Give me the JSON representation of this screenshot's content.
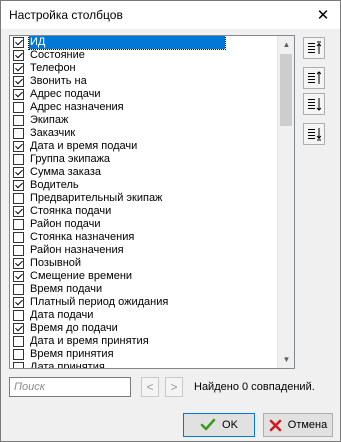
{
  "window": {
    "title": "Настройка столбцов"
  },
  "columns": [
    {
      "label": "ИД",
      "checked": true,
      "selected": true
    },
    {
      "label": "Состояние",
      "checked": true
    },
    {
      "label": "Телефон",
      "checked": true
    },
    {
      "label": "Звонить на",
      "checked": true
    },
    {
      "label": "Адрес подачи",
      "checked": true
    },
    {
      "label": "Адрес назначения",
      "checked": false
    },
    {
      "label": "Экипаж",
      "checked": false
    },
    {
      "label": "Заказчик",
      "checked": false
    },
    {
      "label": "Дата и время подачи",
      "checked": true
    },
    {
      "label": "Группа экипажа",
      "checked": false
    },
    {
      "label": "Сумма заказа",
      "checked": true
    },
    {
      "label": "Водитель",
      "checked": true
    },
    {
      "label": "Предварительный экипаж",
      "checked": false
    },
    {
      "label": "Стоянка подачи",
      "checked": true
    },
    {
      "label": "Район подачи",
      "checked": false
    },
    {
      "label": "Стоянка назначения",
      "checked": false
    },
    {
      "label": "Район назначения",
      "checked": false
    },
    {
      "label": "Позывной",
      "checked": true
    },
    {
      "label": "Смещение времени",
      "checked": true
    },
    {
      "label": "Время подачи",
      "checked": false
    },
    {
      "label": "Платный период ожидания",
      "checked": true
    },
    {
      "label": "Дата подачи",
      "checked": false
    },
    {
      "label": "Время до подачи",
      "checked": true
    },
    {
      "label": "Дата и время принятия",
      "checked": false
    },
    {
      "label": "Время принятия",
      "checked": false
    },
    {
      "label": "Дата принятия",
      "checked": false
    }
  ],
  "side_buttons": [
    {
      "name": "move-top-button",
      "icon": "move-top-icon"
    },
    {
      "name": "move-up-button",
      "icon": "move-up-icon"
    },
    {
      "name": "move-down-button",
      "icon": "move-down-icon"
    },
    {
      "name": "move-bottom-button",
      "icon": "move-bottom-icon"
    }
  ],
  "search": {
    "placeholder": "Поиск",
    "value": ""
  },
  "nav": {
    "prev": "<",
    "next": ">"
  },
  "found_text": "Найдено 0 совпадений.",
  "buttons": {
    "ok": "OK",
    "cancel": "Отмена"
  },
  "colors": {
    "selection": "#0078d7",
    "ok_check": "#3a9d23",
    "cancel_x": "#d11b1b"
  }
}
